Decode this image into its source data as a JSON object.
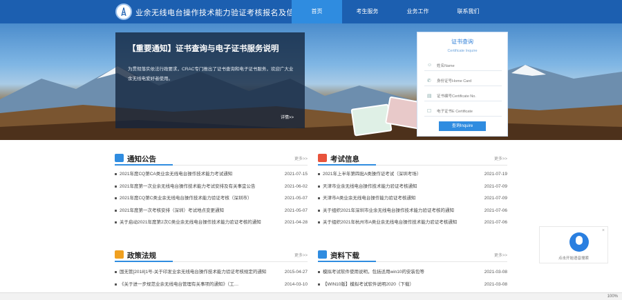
{
  "header": {
    "site_title": "业余无线电台操作技术能力验证考核报名及信息管理系统",
    "nav": [
      "首页",
      "考生服务",
      "业务工作",
      "联系我们"
    ]
  },
  "notice": {
    "title": "【重要通知】证书查询与电子证书服务说明",
    "body": "为贯彻落实依法行政要求，CRAC专门推出了证书查询和电子证书服务，欢迎广大业余无线电爱好者使用。",
    "more": "详情>>"
  },
  "query": {
    "title": "证书查询",
    "subtitle": "Certificate Inquire",
    "name_placeholder": "姓名Name",
    "id_placeholder": "身份证号Home Card",
    "cert_placeholder": "证书编号Certificate No.",
    "ecert_label": "电子证书E Certificate",
    "button": "查询Inquire"
  },
  "sections": {
    "notice": {
      "title": "通知公告",
      "more": "更多>>",
      "rows": [
        {
          "text": "2021年度CQ第CA类业余无线电台操作技术能力考试通知",
          "date": "2021-07-15"
        },
        {
          "text": "2021年度第一次业余无线电台操作技术能力考试安排及有关事宜公告",
          "date": "2021-06-02"
        },
        {
          "text": "2021年度CQ第C类业余无线电台操作技术能力验证考核（深圳市）",
          "date": "2021-05-07"
        },
        {
          "text": "2021年度第一次考核安排（深圳）考试地点变更通知",
          "date": "2021-05-07"
        },
        {
          "text": "关于启动2021年度第2次C类业余无线电台操作技术能力验证考核的通知",
          "date": "2021-04-28"
        }
      ]
    },
    "exam": {
      "title": "考试信息",
      "more": "更多>>",
      "rows": [
        {
          "text": "2021年上半年第四批A类操作证考试（深圳考场）",
          "date": "2021-07-19"
        },
        {
          "text": "天津市业余无线电台操作技术能力验证考核通知",
          "date": "2021-07-09"
        },
        {
          "text": "天津市A类业余无线电台操作能力验证考核通知",
          "date": "2021-07-09"
        },
        {
          "text": "关于组织2021年深圳市业余无线电台操作技术能力验证考核的通知",
          "date": "2021-07-06"
        },
        {
          "text": "关于组织2021年杭州市A类业余无线电台操作技术能力验证考核通知",
          "date": "2021-07-06"
        }
      ]
    },
    "policy": {
      "title": "政策法规",
      "more": "更多>>",
      "rows": [
        {
          "text": "国无管[2018]1号-关于印发业余无线电台操作技术能力验证考核规定的通知",
          "date": "2015-04-27"
        },
        {
          "text": "《关于进一步规范业余无线电台管理有关事项的通知》（工…",
          "date": "2014-03-10"
        }
      ]
    },
    "download": {
      "title": "资料下载",
      "more": "更多>>",
      "rows": [
        {
          "text": "模拟考试软件使用说明，包括适用win10的安装包等",
          "date": "2021-03-08"
        },
        {
          "text": "【WIN10版】模拟考试软件说明2020（下载）",
          "date": "2021-03-08"
        }
      ]
    }
  },
  "voice": {
    "label": "点击开始语音搜索"
  },
  "statusbar": {
    "right": "100%"
  },
  "colors": {
    "header": "#1c5fb0",
    "accent": "#2f8ce0",
    "nav_active": "#2f8ce0"
  }
}
